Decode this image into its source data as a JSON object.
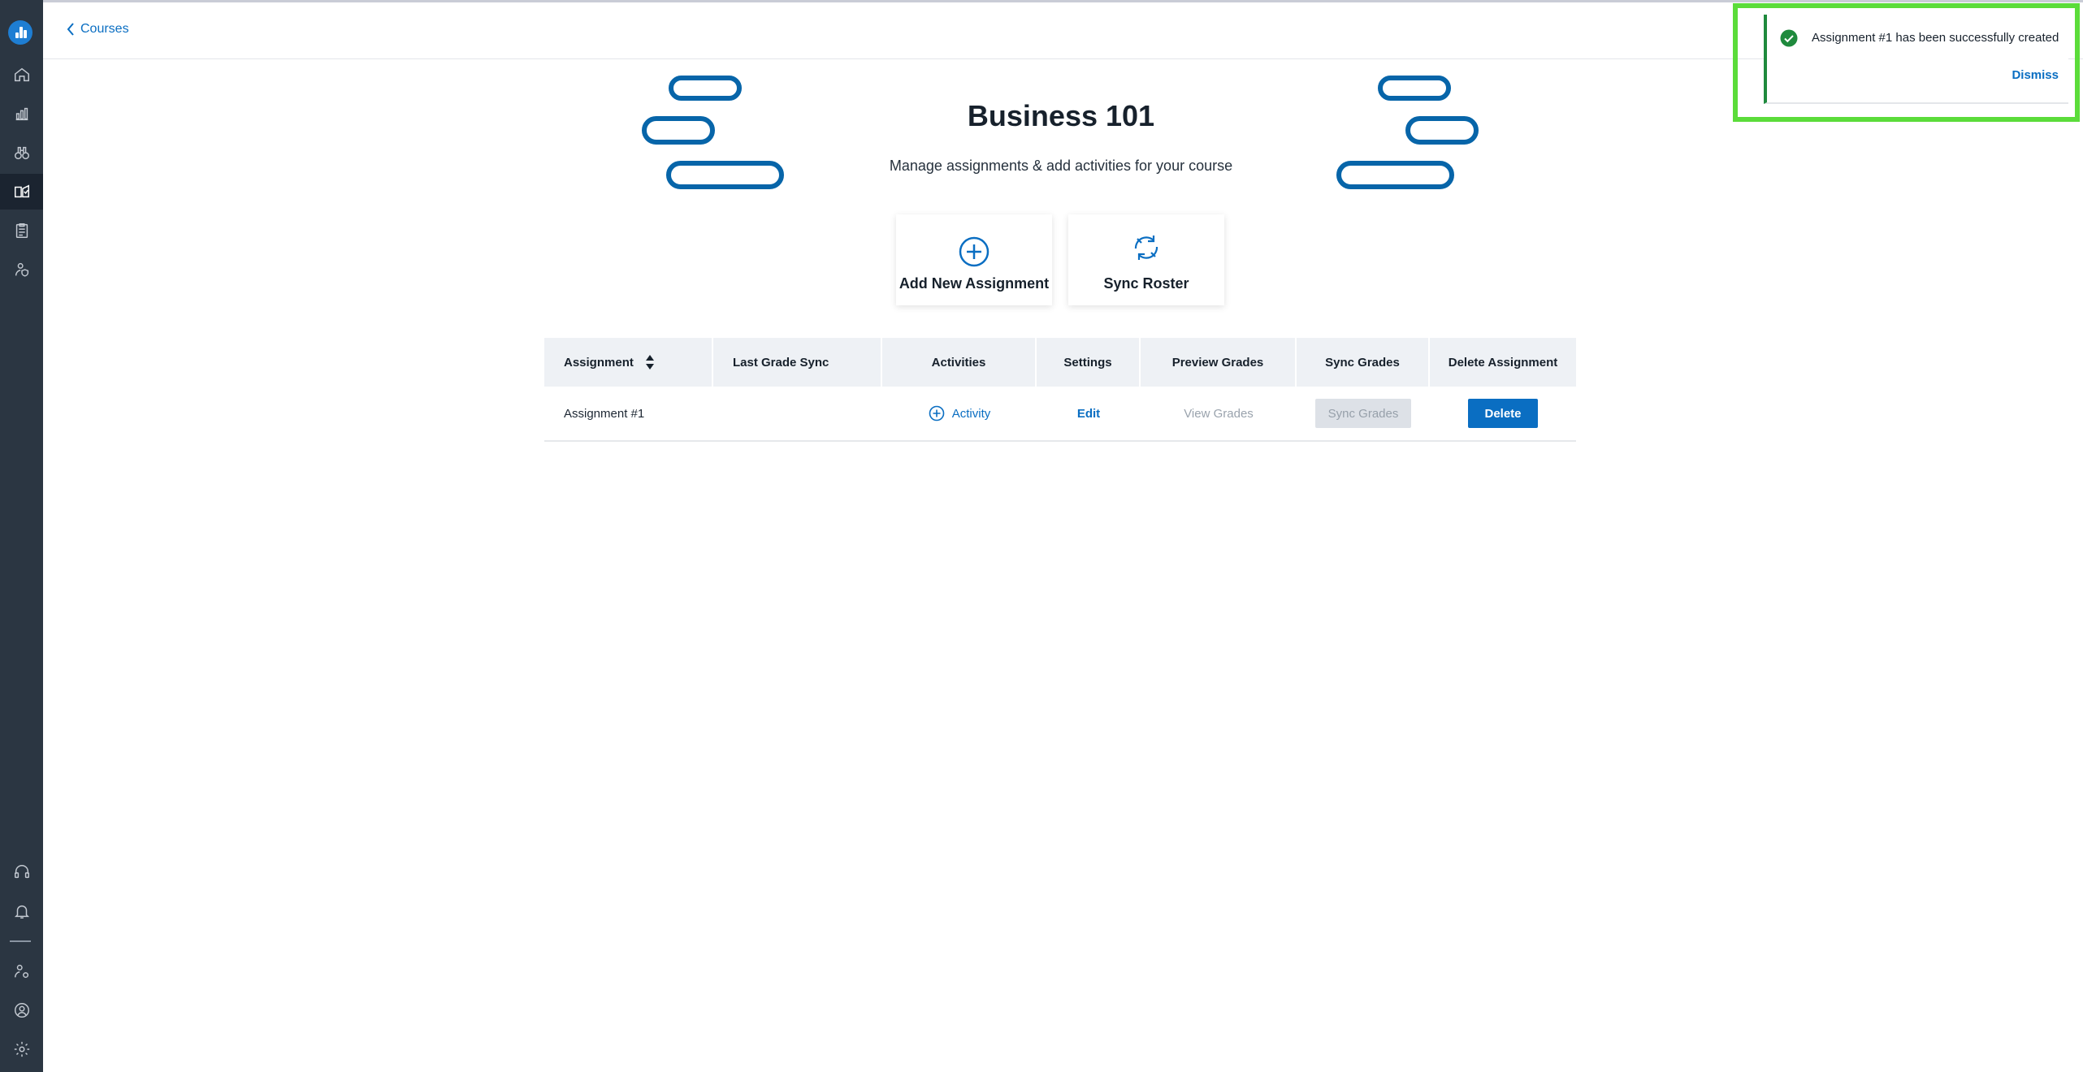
{
  "header": {
    "back_label": "Courses"
  },
  "course": {
    "title": "Business 101",
    "subtitle": "Manage assignments & add activities for your course"
  },
  "actions": {
    "add_assignment_label": "Add New Assignment",
    "sync_roster_label": "Sync Roster"
  },
  "table": {
    "columns": [
      "Assignment",
      "Last Grade Sync",
      "Activities",
      "Settings",
      "Preview Grades",
      "Sync Grades",
      "Delete Assignment"
    ],
    "rows": [
      {
        "assignment": "Assignment #1",
        "last_grade_sync": "",
        "activity_label": "Activity",
        "settings_label": "Edit",
        "preview_label": "View Grades",
        "sync_label": "Sync Grades",
        "delete_label": "Delete"
      }
    ]
  },
  "toast": {
    "message": "Assignment #1 has been successfully created",
    "dismiss_label": "Dismiss"
  },
  "sidebar": {
    "items": [
      "home-icon",
      "analytics-icon",
      "binoculars-icon",
      "courses-icon",
      "clipboard-icon",
      "user-shield-icon",
      "support-icon",
      "bell-icon",
      "user-settings-icon",
      "profile-icon",
      "gear-icon"
    ]
  },
  "colors": {
    "sidebar_bg": "#2b3642",
    "accent": "#0a6ec2",
    "success": "#1f8a3d",
    "highlight": "#5bdc3a"
  }
}
